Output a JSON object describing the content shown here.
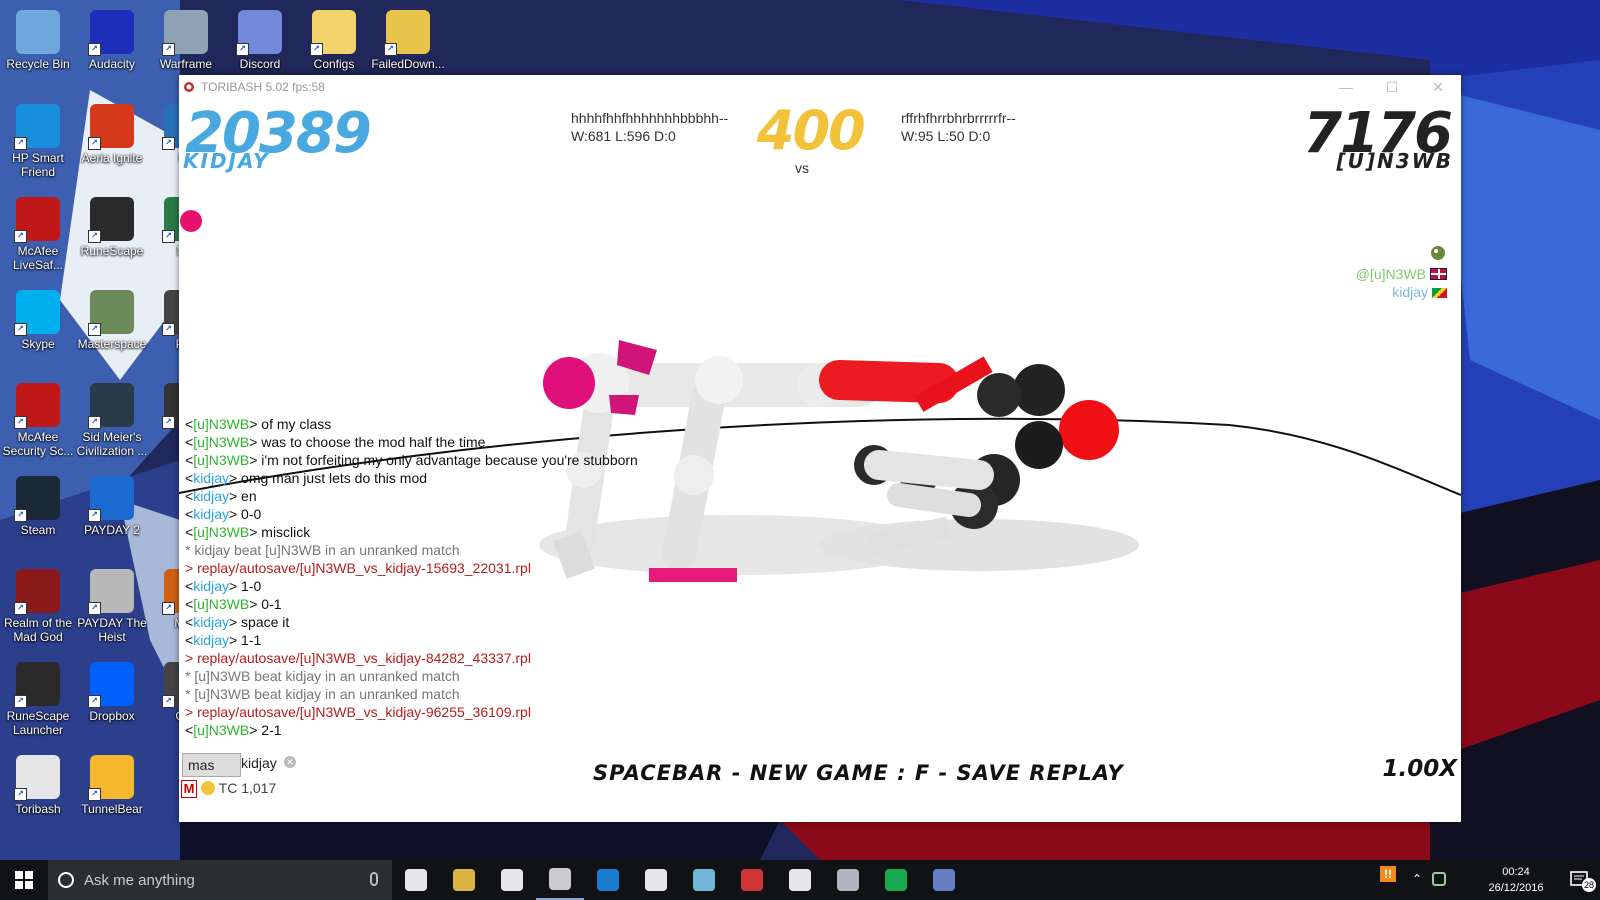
{
  "desktop": {
    "icons": [
      {
        "label": "Recycle Bin",
        "icon": "recycle-bin-icon",
        "color": "#6fa8dc"
      },
      {
        "label": "Audacity",
        "icon": "audacity-icon",
        "color": "#1c2db8"
      },
      {
        "label": "Warframe",
        "icon": "warframe-icon",
        "color": "#8fa3b5"
      },
      {
        "label": "Discord",
        "icon": "discord-icon",
        "color": "#7289da"
      },
      {
        "label": "Configs",
        "icon": "folder-icon",
        "color": "#f3d36c"
      },
      {
        "label": "FailedDown...",
        "icon": "folder-icon",
        "color": "#e8c44a"
      },
      {
        "label": "HP Smart Friend",
        "icon": "hp-icon",
        "color": "#1a8fe0"
      },
      {
        "label": "Aeria Ignite",
        "icon": "aeria-icon",
        "color": "#d43a1a"
      },
      {
        "label": "Pa",
        "icon": "app-icon",
        "color": "#2a70b8"
      },
      {
        "label": "McAfee LiveSaf...",
        "icon": "mcafee-icon",
        "color": "#c01818"
      },
      {
        "label": "RuneScape",
        "icon": "runescape-icon",
        "color": "#2a2a2a"
      },
      {
        "label": "Mic",
        "icon": "app-icon",
        "color": "#2a7a4a"
      },
      {
        "label": "Skype",
        "icon": "skype-icon",
        "color": "#00aff0"
      },
      {
        "label": "Masterspace",
        "icon": "masterspace-icon",
        "color": "#6a8a5a"
      },
      {
        "label": "Pok",
        "icon": "app-icon",
        "color": "#444444"
      },
      {
        "label": "McAfee Security Sc...",
        "icon": "mcafee-icon",
        "color": "#c01818"
      },
      {
        "label": "Sid Meier's Civilization ...",
        "icon": "civilization-icon",
        "color": "#2a3a4a"
      },
      {
        "label": "G",
        "icon": "app-icon",
        "color": "#333333"
      },
      {
        "label": "Steam",
        "icon": "steam-icon",
        "color": "#1b2838"
      },
      {
        "label": "PAYDAY 2",
        "icon": "payday-icon",
        "color": "#1a6ad0"
      },
      {
        "label": "Realm of the Mad God",
        "icon": "realm-icon",
        "color": "#8a1a1a"
      },
      {
        "label": "PAYDAY The Heist",
        "icon": "payday-mask-icon",
        "color": "#b8b8b8"
      },
      {
        "label": "M Fi",
        "icon": "app-icon",
        "color": "#d06010"
      },
      {
        "label": "RuneScape Launcher",
        "icon": "runescape-icon",
        "color": "#2a2a2a"
      },
      {
        "label": "Dropbox",
        "icon": "dropbox-icon",
        "color": "#0061fe"
      },
      {
        "label": "Cas",
        "icon": "app-icon",
        "color": "#444444"
      },
      {
        "label": "Toribash",
        "icon": "toribash-icon",
        "color": "#e6e6e6"
      },
      {
        "label": "TunnelBear",
        "icon": "tunnelbear-icon",
        "color": "#f5b82e"
      }
    ]
  },
  "window": {
    "title": "TORIBASH 5.02 fps:58",
    "controls": {
      "minimize": "—",
      "maximize": "☐",
      "close": "✕"
    }
  },
  "game": {
    "player1": {
      "score": "20389",
      "name": "KIDJAY",
      "title": "hhhhfhhfhhhhhhhbbbhh--",
      "record": "W:681 L:596 D:0",
      "color": "#4aa8e0"
    },
    "player2": {
      "score": "7176",
      "name": "[U]N3WB",
      "title": "rffrhfhrrbhrbrrrrrfr--",
      "record": "W:95 L:50 D:0",
      "color": "#222222"
    },
    "timer": "400",
    "vs": "vs",
    "timer_color": "#f2c23a",
    "online_users": [
      {
        "name": "@[u]N3WB",
        "color": "#7ec86a",
        "flag": "uk"
      },
      {
        "name": "kidjay",
        "color": "#7ab9e0",
        "flag": "gy"
      }
    ],
    "chat": [
      {
        "type": "msg",
        "user": "[u]N3WB",
        "color": "green",
        "text": " of my class"
      },
      {
        "type": "msg",
        "user": "[u]N3WB",
        "color": "green",
        "text": " was to choose the mod half the time"
      },
      {
        "type": "msg",
        "user": "[u]N3WB",
        "color": "green",
        "text": " i'm not forfeiting my only advantage because you're stubborn"
      },
      {
        "type": "msg",
        "user": "kidjay",
        "color": "blue",
        "text": " omg man just lets do this mod"
      },
      {
        "type": "msg",
        "user": "kidjay",
        "color": "blue",
        "text": " en"
      },
      {
        "type": "msg",
        "user": "kidjay",
        "color": "blue",
        "text": " 0-0"
      },
      {
        "type": "msg",
        "user": "[u]N3WB",
        "color": "green",
        "text": " misclick"
      },
      {
        "type": "sys",
        "text": " * kidjay beat [u]N3WB in an unranked match"
      },
      {
        "type": "rep",
        "text": "> replay/autosave/[u]N3WB_vs_kidjay-15693_22031.rpl"
      },
      {
        "type": "msg",
        "user": "kidjay",
        "color": "blue",
        "text": " 1-0"
      },
      {
        "type": "msg",
        "user": "[u]N3WB",
        "color": "green",
        "text": " 0-1"
      },
      {
        "type": "msg",
        "user": "kidjay",
        "color": "blue",
        "text": " space it"
      },
      {
        "type": "msg",
        "user": "kidjay",
        "color": "blue",
        "text": " 1-1"
      },
      {
        "type": "rep",
        "text": "> replay/autosave/[u]N3WB_vs_kidjay-84282_43337.rpl"
      },
      {
        "type": "sys",
        "text": " * [u]N3WB beat kidjay in an unranked match"
      },
      {
        "type": "sys",
        "text": " * [u]N3WB beat kidjay in an unranked match"
      },
      {
        "type": "rep",
        "text": "> replay/autosave/[u]N3WB_vs_kidjay-96255_36109.rpl"
      },
      {
        "type": "msg",
        "user": "[u]N3WB",
        "color": "green",
        "text": " 2-1"
      }
    ],
    "input_value": "mas",
    "input_user": "kidjay",
    "mod_badge": "M",
    "tc": "TC 1,017",
    "hint": "SPACEBAR - NEW GAME   :   F - SAVE REPLAY",
    "speed": "1.00X"
  },
  "taskbar": {
    "search_placeholder": "Ask me anything",
    "time": "00:24",
    "date": "26/12/2016",
    "notifications": "28",
    "apps": [
      {
        "name": "task-view-icon",
        "color": "#ffffff"
      },
      {
        "name": "file-explorer-icon",
        "color": "#f3c54a"
      },
      {
        "name": "store-icon",
        "color": "#ffffff"
      },
      {
        "name": "toribash-icon",
        "color": "#e0e0e0"
      },
      {
        "name": "edge-icon",
        "color": "#1e88e5"
      },
      {
        "name": "amazon-icon",
        "color": "#ffffff"
      },
      {
        "name": "flight-icon",
        "color": "#7ec8f0"
      },
      {
        "name": "wps-icon",
        "color": "#e53935"
      },
      {
        "name": "dropbox-icon",
        "color": "#ffffff"
      },
      {
        "name": "steam-icon",
        "color": "#c0c8d0"
      },
      {
        "name": "spotify-icon",
        "color": "#1db954"
      },
      {
        "name": "discord-icon",
        "color": "#7289da"
      }
    ]
  }
}
